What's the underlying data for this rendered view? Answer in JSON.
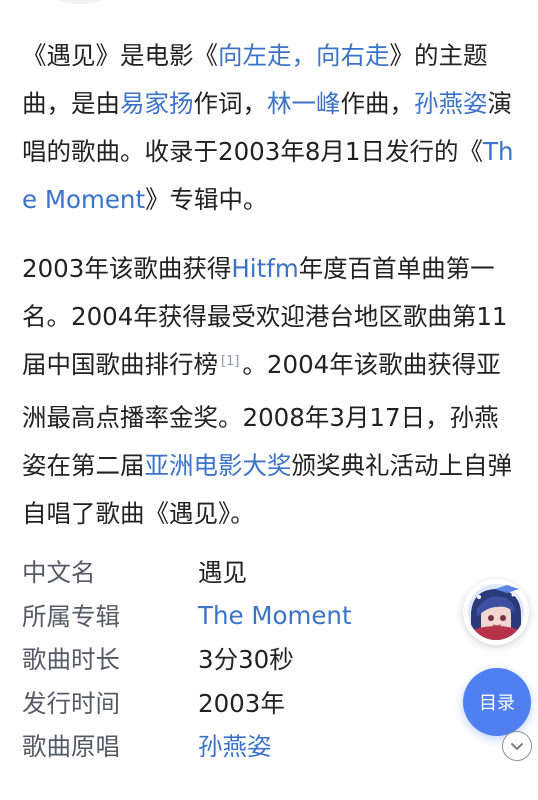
{
  "intro": {
    "s1": "《遇见》是电影《",
    "movie_link": "向左走，向右走",
    "s2": "》的主题曲，是由",
    "lyricist_link": "易家扬",
    "s3": "作词，",
    "composer_link": "林一峰",
    "s4": "作曲，",
    "singer_link": "孙燕姿",
    "s5": "演唱的歌曲。收录于2003年8月1日发行的《",
    "album_link": "The Moment",
    "s6": "》专辑中。"
  },
  "awards": {
    "s1": "2003年该歌曲获得",
    "hitfm_link": "Hitfm",
    "s2": "年度百首单曲第一名。2004年获得最受欢迎港台地区歌曲第11届中国歌曲排行榜",
    "citation": "[1]",
    "s3": "。2004年该歌曲获得亚洲最高点播率金奖。2008年3月17日，孙燕姿在第二届",
    "award_link": "亚洲电影大奖",
    "s4": "颁奖典礼活动上自弹自唱了歌曲《遇见》。"
  },
  "infobox": [
    {
      "key": "中文名",
      "value": "遇见"
    },
    {
      "key": "所属专辑",
      "value": "The Moment"
    },
    {
      "key": "歌曲时长",
      "value": "3分30秒"
    },
    {
      "key": "发行时间",
      "value": "2003年"
    },
    {
      "key": "歌曲原唱",
      "value": "孙燕姿"
    }
  ],
  "floating": {
    "toc_label": "目录",
    "avatar_icon": "anime-avatar-icon",
    "expand_icon": "chevron-down-icon"
  },
  "colors": {
    "link": "#3b73c8",
    "toc_button": "#4f7ff0"
  }
}
